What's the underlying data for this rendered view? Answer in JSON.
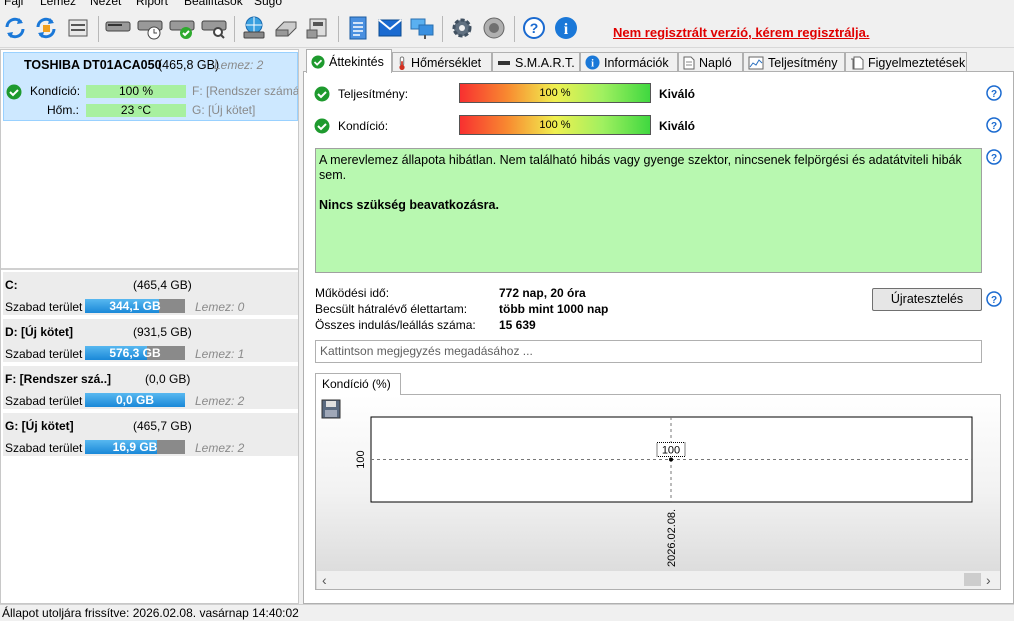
{
  "menu": [
    "Fájl",
    "Lemez",
    "Nézet",
    "Riport",
    "Beállítások",
    "Súgó"
  ],
  "toolbar": {
    "register_link": "Nem regisztrált verzió, kérem regisztrálja."
  },
  "disk": {
    "name": "TOSHIBA DT01ACA050",
    "size": "(465,8 GB)",
    "disk_index": "Lemez: 2",
    "condition_label": "Kondíció:",
    "condition_value": "100 %",
    "temp_label": "Hőm.:",
    "temp_value": "23 °C",
    "vol_f": "F: [Rendszer számára",
    "vol_g": "G: [Új kötet]"
  },
  "volumes": [
    {
      "name": "C:",
      "size": "(465,4 GB)",
      "free_label": "Szabad terület",
      "free": "344,1 GB",
      "free_fraction": 0.74,
      "disk": "Lemez: 0"
    },
    {
      "name": "D: [Új kötet]",
      "size": "(931,5 GB)",
      "free_label": "Szabad terület",
      "free": "576,3 GB",
      "free_fraction": 0.62,
      "disk": "Lemez: 1"
    },
    {
      "name": "F: [Rendszer szá..]",
      "size": "(0,0 GB)",
      "free_label": "Szabad terület",
      "free": "0,0 GB",
      "free_fraction": 1.0,
      "disk": "Lemez: 2"
    },
    {
      "name": "G: [Új kötet]",
      "size": "(465,7 GB)",
      "free_label": "Szabad terület",
      "free": "16,9 GB",
      "free_fraction": 0.72,
      "disk": "Lemez: 2"
    }
  ],
  "tabs": [
    "Áttekintés",
    "Hőmérséklet",
    "S.M.A.R.T.",
    "Információk",
    "Napló",
    "Teljesítmény",
    "Figyelmeztetések"
  ],
  "overview": {
    "performance_label": "Teljesítmény:",
    "performance_value": "100 %",
    "performance_rating": "Kiváló",
    "condition_label": "Kondíció:",
    "condition_value": "100 %",
    "condition_rating": "Kiváló",
    "status_text": "A merevlemez állapota hibátlan. Nem található hibás vagy gyenge szektor, nincsenek felpörgési és adatátviteli hibák sem.",
    "status_action": "Nincs szükség beavatkozásra.",
    "uptime_label": "Működési idő:",
    "uptime_value": "772 nap, 20 óra",
    "lifetime_label": "Becsült hátralévő élettartam:",
    "lifetime_value": "több mint 1000 nap",
    "startstop_label": "Összes indulás/leállás száma:",
    "startstop_value": "15 639",
    "retest_button": "Újratesztelés",
    "note_placeholder": "Kattintson megjegyzés megadásához ...",
    "chart_tab": "Kondíció  (%)"
  },
  "chart_data": {
    "type": "line",
    "x": [
      "2026.02.08."
    ],
    "series": [
      {
        "values": [
          100
        ]
      }
    ],
    "y_tick": "100",
    "data_label": "100",
    "x_tick": "2026.02.08."
  },
  "status_bar": "Állapot utoljára frissítve: 2026.02.08. vasárnap 14:40:02",
  "colors": {
    "accent": "#1a88d8",
    "good": "#b8f8b0",
    "warn_text": "#e00000"
  }
}
